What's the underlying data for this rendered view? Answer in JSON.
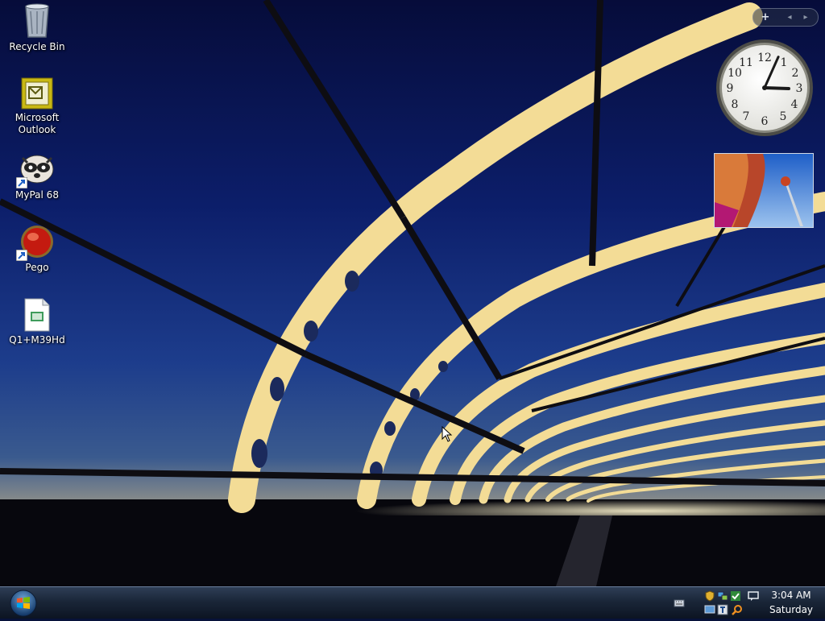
{
  "desktop": {
    "icons": [
      {
        "label": "Recycle Bin",
        "icon": "recycle-bin-icon"
      },
      {
        "label": "Microsoft\nOutlook",
        "icon": "outlook-icon"
      },
      {
        "label": "MyPal 68",
        "icon": "mypal-icon",
        "shortcut": true
      },
      {
        "label": "Pego",
        "icon": "pego-icon",
        "shortcut": true
      },
      {
        "label": "Q1+M39Hd",
        "icon": "document-icon"
      }
    ]
  },
  "sidebar": {
    "add_gadget": "+",
    "prev": "◂",
    "next": "▸",
    "clock": {
      "hour": 3,
      "minute": 4
    }
  },
  "taskbar": {
    "time": "3:04 AM",
    "day": "Saturday"
  },
  "colors": {
    "accent": "#2f4b7a",
    "sky_top": "#0a1450",
    "glow": "#f6e6a8"
  }
}
